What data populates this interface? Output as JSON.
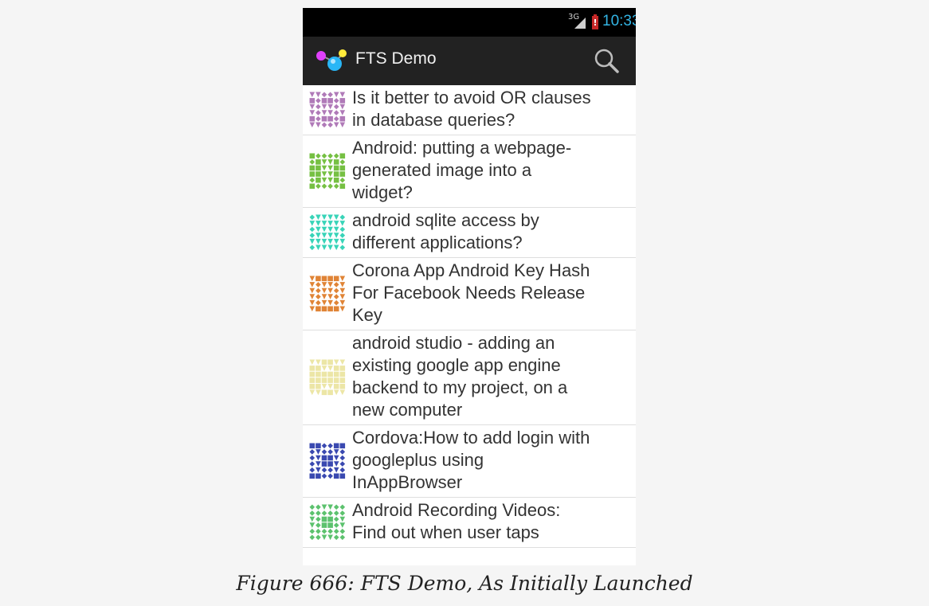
{
  "status_bar": {
    "network": "3G",
    "time": "10:33",
    "accent": "#33b5e5"
  },
  "action_bar": {
    "title": "FTS Demo",
    "background": "#222222",
    "search_icon": "search-icon"
  },
  "questions": [
    {
      "text": "Is it better to avoid OR clauses\nin database queries?",
      "color": "#b07ab8",
      "avatar": "identicon-1"
    },
    {
      "text": "Android: putting a webpage-\ngenerated image into a\nwidget?",
      "color": "#76c043",
      "avatar": "identicon-2"
    },
    {
      "text": "android sqlite access by\ndifferent applications?",
      "color": "#38d4b8",
      "avatar": "identicon-3"
    },
    {
      "text": "Corona App Android Key Hash\nFor Facebook Needs Release\nKey",
      "color": "#e08436",
      "avatar": "identicon-4"
    },
    {
      "text": "android studio - adding an\nexisting google app engine\nbackend to my project, on a\nnew computer",
      "color": "#ece6a6",
      "avatar": "identicon-5"
    },
    {
      "text": "Cordova:How to add login with\ngoogleplus using\nInAppBrowser",
      "color": "#3a49b0",
      "avatar": "identicon-6"
    },
    {
      "text": "Android Recording Videos:\nFind out when user taps",
      "color": "#5cc26e",
      "avatar": "identicon-7"
    }
  ],
  "caption": "Figure 666: FTS Demo, As Initially Launched"
}
